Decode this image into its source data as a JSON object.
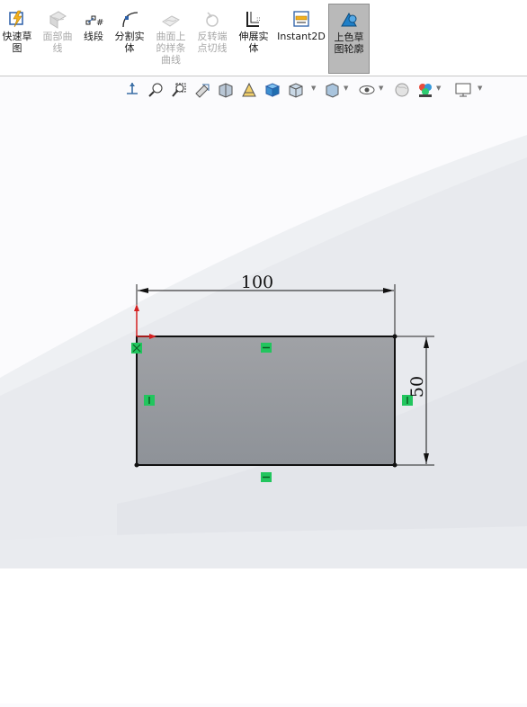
{
  "ribbon": {
    "tools": [
      {
        "label": "快速草\n图",
        "icon": "quick-sketch-icon"
      },
      {
        "label": "面部曲\n线",
        "icon": "face-curves-icon",
        "disabled": true
      },
      {
        "label": "线段",
        "icon": "segment-icon"
      },
      {
        "label": "分割实\n体",
        "icon": "split-entities-icon"
      },
      {
        "label": "曲面上\n的样条\n曲线",
        "icon": "spline-on-surface-icon",
        "disabled": true
      },
      {
        "label": "反转端\n点切线",
        "icon": "reverse-endpoint-tangent-icon",
        "disabled": true
      },
      {
        "label": "伸展实\n体",
        "icon": "stretch-entities-icon"
      },
      {
        "label": "Instant2D",
        "icon": "instant2d-icon"
      },
      {
        "label": "上色草\n图轮廓",
        "icon": "shaded-sketch-contours-icon",
        "active": true
      }
    ]
  },
  "view_toolbar": {
    "icons": [
      "view-orientation-icon",
      "zoom-to-fit-icon",
      "zoom-to-area-icon",
      "previous-view-icon",
      "section-view-icon",
      "dynamic-annotation-icon",
      "view-orientation-cube-icon",
      "display-style-icon",
      "hide-show-items-icon",
      "edit-appearance-icon",
      "apply-scene-icon",
      "view-settings-icon"
    ]
  },
  "sketch": {
    "width_dimension": "100",
    "height_dimension": "50",
    "relations": [
      "horizontal-relation",
      "vertical-relation",
      "vertical-relation",
      "horizontal-relation",
      "coincident-relation"
    ]
  },
  "colors": {
    "sketch_fill": "#9a9ea4",
    "relation_green": "#22c55e",
    "origin_red": "#d42020"
  }
}
